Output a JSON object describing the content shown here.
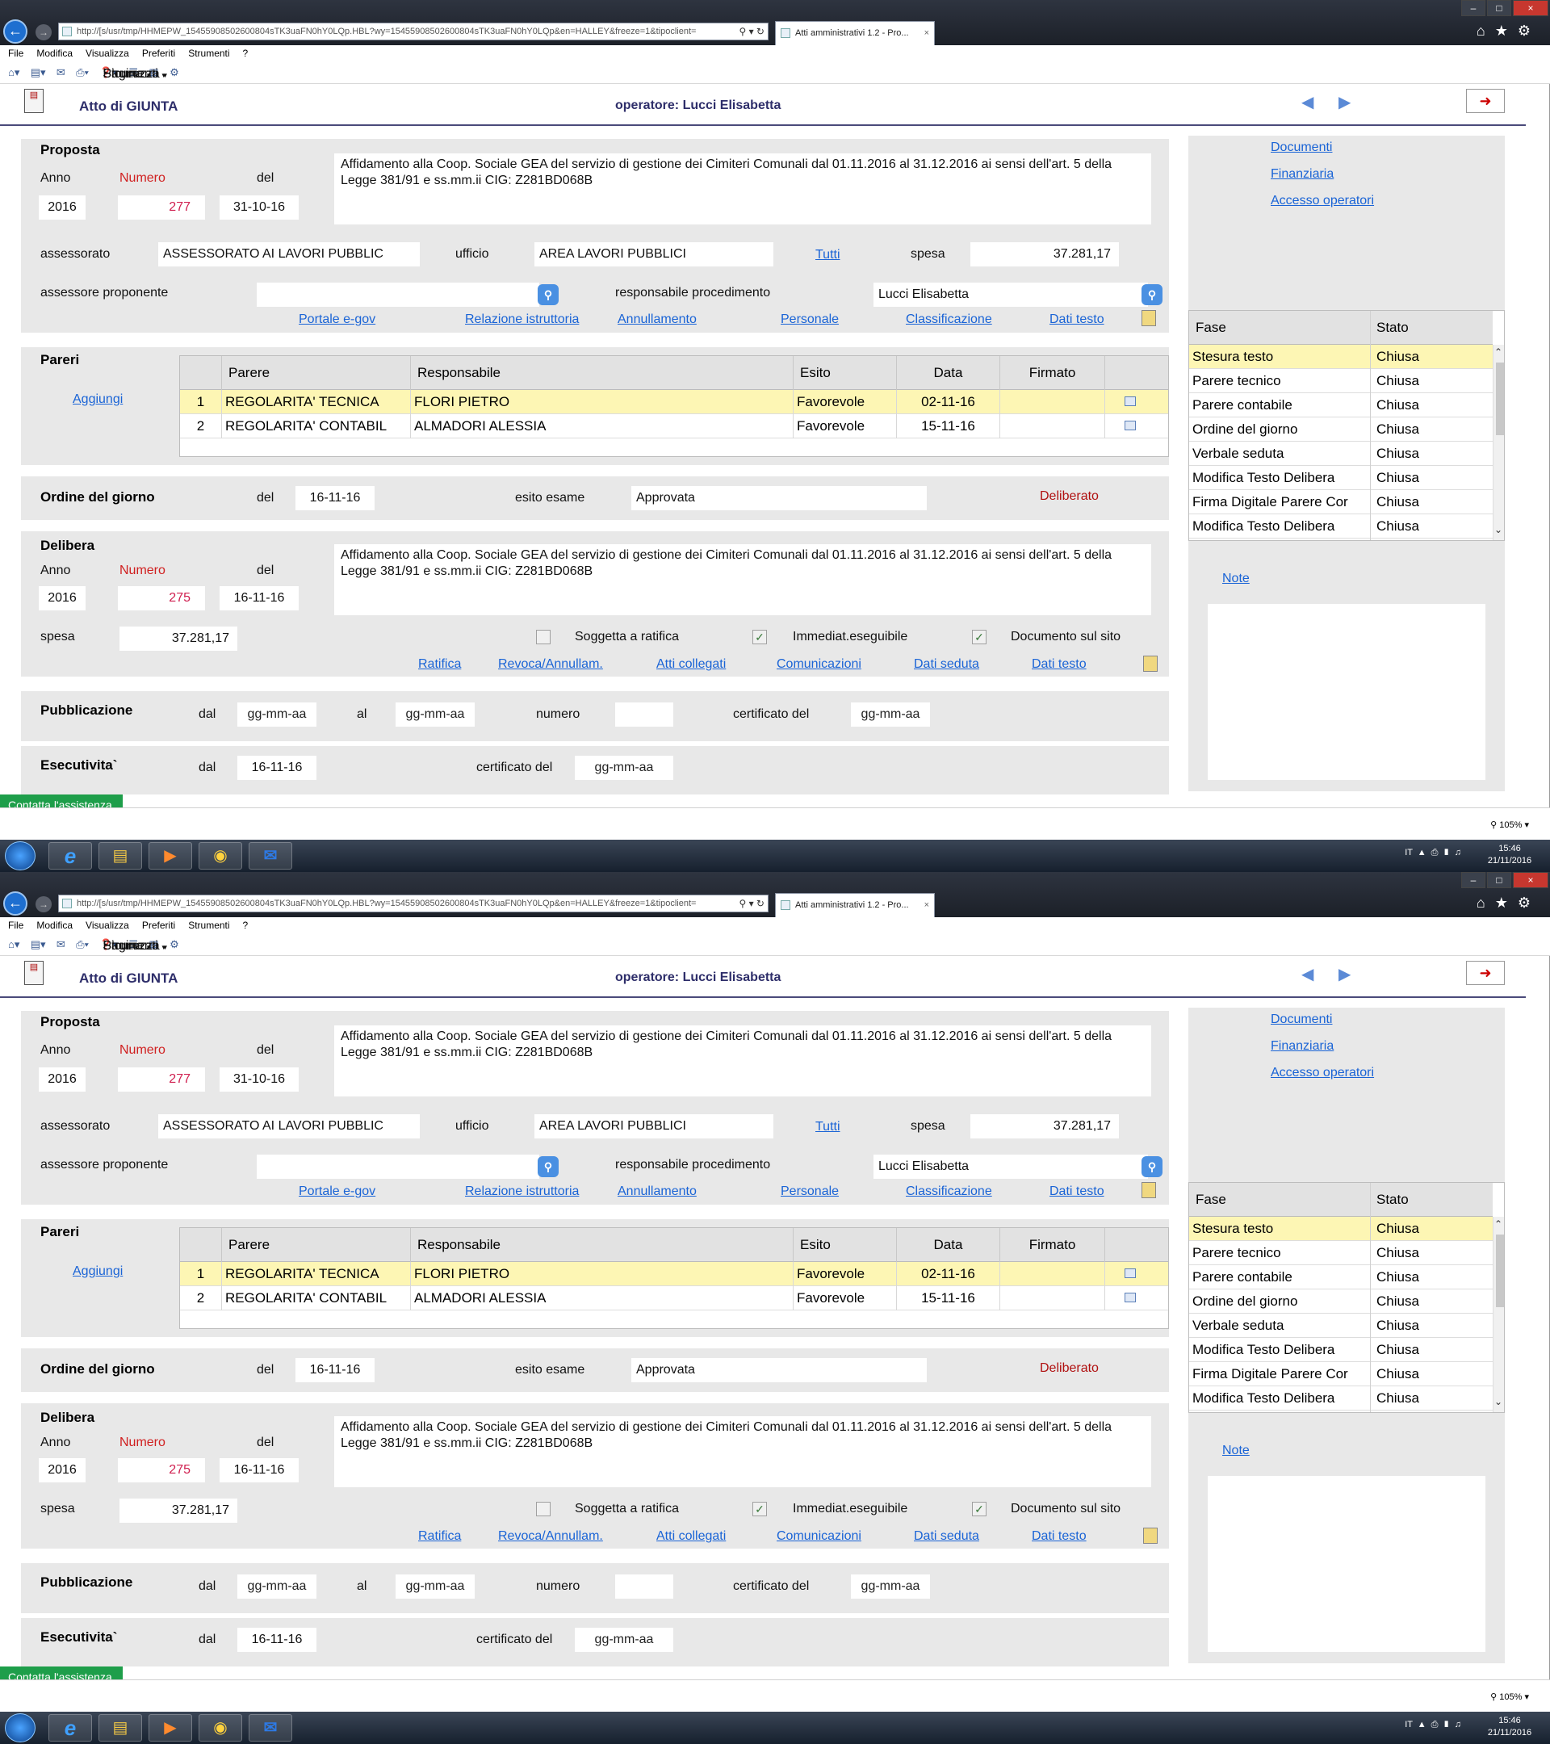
{
  "browser": {
    "address": "http://[s/usr/tmp/HHMEPW_15455908502600804sTK3uaFN0hY0LQp.HBL?wy=15455908502600804sTK3uaFN0hY0LQp&en=HALLEY&freeze=1&tipoclient=",
    "tab_title": "Atti amministrativi 1.2 - Pro...",
    "menu": [
      "File",
      "Modifica",
      "Visualizza",
      "Preferiti",
      "Strumenti",
      "?"
    ],
    "toolbar": {
      "pagina": "Pagina",
      "sicurezza": "Sicurezza",
      "strumenti": "Strumenti"
    },
    "zoom": "105%"
  },
  "app": {
    "title": "Atto di GIUNTA",
    "operator": "operatore: Lucci Elisabetta"
  },
  "proposta": {
    "title": "Proposta",
    "anno_label": "Anno",
    "numero_label": "Numero",
    "del_label": "del",
    "anno": "2016",
    "numero": "277",
    "del": "31-10-16",
    "oggetto": "Affidamento alla Coop. Sociale GEA del servizio di gestione dei Cimiteri Comunali dal 01.11.2016 al 31.12.2016 ai sensi dell'art. 5 della Legge 381/91 e ss.mm.ii CIG: Z281BD068B",
    "assessorato_label": "assessorato",
    "assessorato": "ASSESSORATO AI LAVORI PUBBLIC",
    "ufficio_label": "ufficio",
    "ufficio": "AREA LAVORI PUBBLICI",
    "tutti": "Tutti",
    "spesa_label": "spesa",
    "spesa": "37.281,17",
    "assessore_label": "assessore proponente",
    "assessore": "",
    "responsabile_label": "responsabile procedimento",
    "responsabile": "Lucci Elisabetta",
    "links": [
      "Portale e-gov",
      "Relazione istruttoria",
      "Annullamento",
      "Personale",
      "Classificazione",
      "Dati testo"
    ]
  },
  "pareri": {
    "title": "Pareri",
    "add": "Aggiungi",
    "columns": [
      "Parere",
      "Responsabile",
      "Esito",
      "Data",
      "Firmato"
    ],
    "rows": [
      {
        "n": "1",
        "parere": "REGOLARITA' TECNICA",
        "responsabile": "FLORI PIETRO",
        "esito": "Favorevole",
        "data": "02-11-16",
        "firmato": ""
      },
      {
        "n": "2",
        "parere": "REGOLARITA' CONTABIL",
        "responsabile": "ALMADORI ALESSIA",
        "esito": "Favorevole",
        "data": "15-11-16",
        "firmato": ""
      }
    ]
  },
  "ordine": {
    "title": "Ordine del giorno",
    "del_label": "del",
    "del": "16-11-16",
    "esito_label": "esito esame",
    "esito": "Approvata",
    "stato": "Deliberato"
  },
  "delibera": {
    "title": "Delibera",
    "anno_label": "Anno",
    "numero_label": "Numero",
    "del_label": "del",
    "anno": "2016",
    "numero": "275",
    "del": "16-11-16",
    "oggetto": "Affidamento alla Coop. Sociale GEA del servizio di gestione dei Cimiteri Comunali dal 01.11.2016 al 31.12.2016 ai sensi dell'art. 5 della Legge 381/91 e ss.mm.ii CIG: Z281BD068B",
    "spesa_label": "spesa",
    "spesa": "37.281,17",
    "soggetta": "Soggetta a ratifica",
    "immediat": "Immediat.eseguibile",
    "documento": "Documento sul sito",
    "links": [
      "Ratifica",
      "Revoca/Annullam.",
      "Atti collegati",
      "Comunicazioni",
      "Dati seduta",
      "Dati testo"
    ]
  },
  "pubblicazione": {
    "title": "Pubblicazione",
    "dal_label": "dal",
    "dal": "gg-mm-aa",
    "al_label": "al",
    "al": "gg-mm-aa",
    "numero_label": "numero",
    "numero": "",
    "certificato_label": "certificato del",
    "certificato": "gg-mm-aa"
  },
  "esecutivita": {
    "title": "Esecutivita`",
    "dal_label": "dal",
    "dal": "16-11-16",
    "certificato_label": "certificato del",
    "certificato": "gg-mm-aa"
  },
  "side": {
    "links": [
      "Documenti",
      "Finanziaria",
      "Accesso operatori"
    ],
    "fase_header": "Fase",
    "stato_header": "Stato",
    "fasi": [
      {
        "fase": "Stesura testo",
        "stato": "Chiusa"
      },
      {
        "fase": "Parere tecnico",
        "stato": "Chiusa"
      },
      {
        "fase": "Parere contabile",
        "stato": "Chiusa"
      },
      {
        "fase": "Ordine del giorno",
        "stato": "Chiusa"
      },
      {
        "fase": "Verbale seduta",
        "stato": "Chiusa"
      },
      {
        "fase": "Modifica Testo Delibera",
        "stato": "Chiusa"
      },
      {
        "fase": "Firma Digitale Parere Cor",
        "stato": "Chiusa"
      },
      {
        "fase": "Modifica Testo Delibera",
        "stato": "Chiusa"
      }
    ],
    "note": "Note"
  },
  "assist": "Contatta l'assistenza",
  "taskbar": {
    "lang": "IT",
    "time": "15:46",
    "date": "21/11/2016"
  },
  "colors": {
    "panel": "#e8e8e8",
    "link": "#1a64d6",
    "selected_row": "#fdf6b4",
    "title": "#2e2e6a",
    "assist": "#1e9e4a"
  }
}
